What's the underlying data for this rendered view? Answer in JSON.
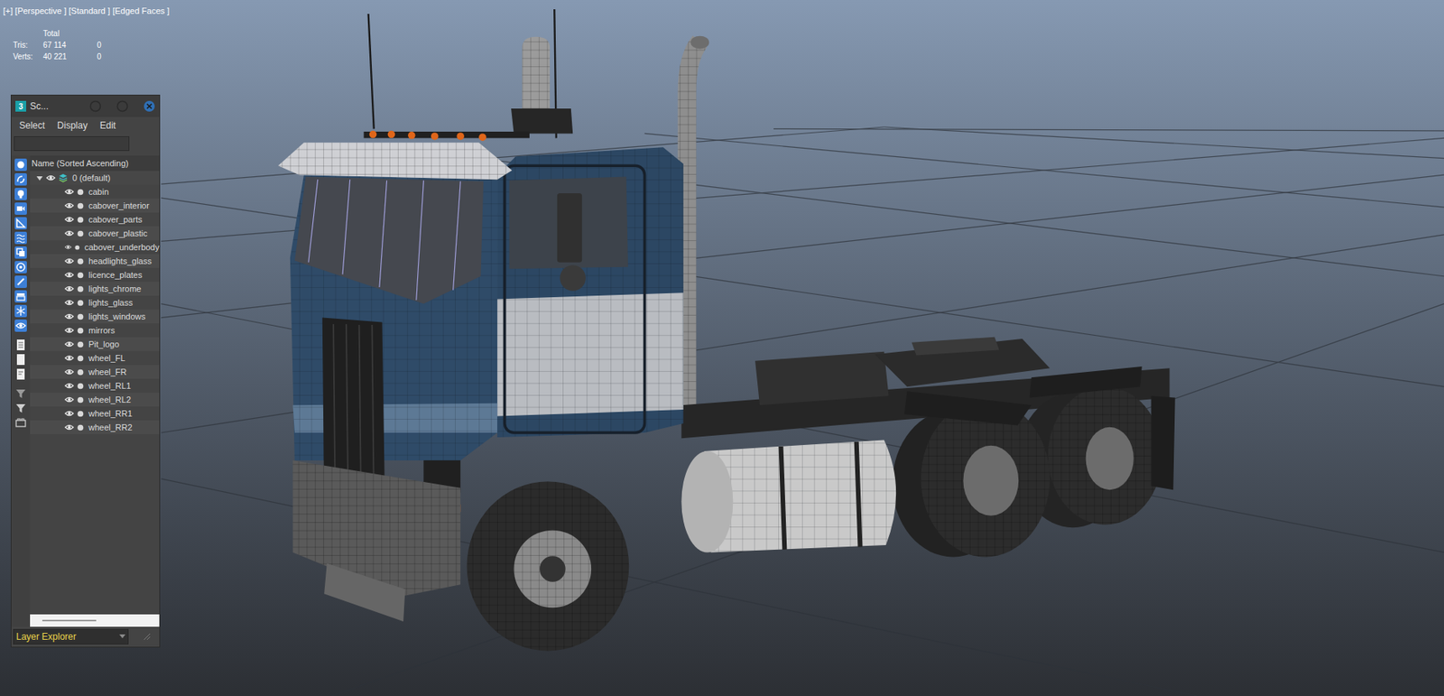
{
  "viewport": {
    "label": "[+] [Perspective ] [Standard ] [Edged Faces ]",
    "stats": {
      "header": "Total",
      "rows": [
        {
          "label": "Tris:",
          "total": "67 114",
          "selected": "0"
        },
        {
          "label": "Verts:",
          "total": "40 221",
          "selected": "0"
        }
      ]
    }
  },
  "scene_explorer": {
    "app_icon": "3",
    "title": "Sc...",
    "menu": [
      "Select",
      "Display",
      "Edit"
    ],
    "search": {
      "value": ""
    },
    "column_header": "Name (Sorted Ascending)",
    "layer": {
      "name": "0 (default)",
      "expanded": true,
      "visible": true
    },
    "objects": [
      {
        "name": "cabin",
        "visible": true
      },
      {
        "name": "cabover_interior",
        "visible": true
      },
      {
        "name": "cabover_parts",
        "visible": true
      },
      {
        "name": "cabover_plastic",
        "visible": true
      },
      {
        "name": "cabover_underbody",
        "visible": true
      },
      {
        "name": "headlights_glass",
        "visible": true
      },
      {
        "name": "licence_plates",
        "visible": true
      },
      {
        "name": "lights_chrome",
        "visible": true
      },
      {
        "name": "lights_glass",
        "visible": true
      },
      {
        "name": "lights_windows",
        "visible": true
      },
      {
        "name": "mirrors",
        "visible": true
      },
      {
        "name": "Pit_logo",
        "visible": true
      },
      {
        "name": "wheel_FL",
        "visible": true
      },
      {
        "name": "wheel_FR",
        "visible": true
      },
      {
        "name": "wheel_RL1",
        "visible": true
      },
      {
        "name": "wheel_RL2",
        "visible": true
      },
      {
        "name": "wheel_RR1",
        "visible": true
      },
      {
        "name": "wheel_RR2",
        "visible": true
      }
    ],
    "footer_dropdown": "Layer Explorer"
  }
}
